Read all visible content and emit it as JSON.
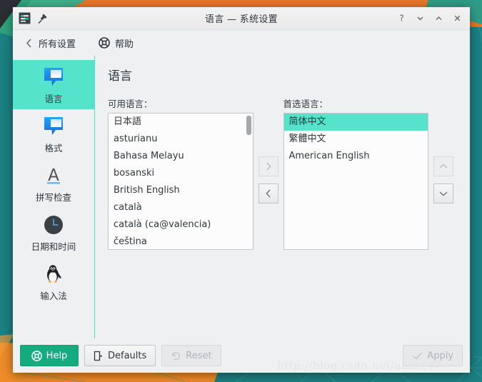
{
  "window": {
    "title": "语言 — 系统设置",
    "app_icon": "settings-sliders-icon",
    "pin_icon": "pin-icon",
    "controls": [
      {
        "name": "help-button",
        "glyph": "?"
      },
      {
        "name": "minimize-button",
        "glyph": "⌄"
      },
      {
        "name": "maximize-button",
        "glyph": "⌃"
      },
      {
        "name": "close-button",
        "glyph": "✕"
      }
    ]
  },
  "toolbar": {
    "back_label": "所有设置",
    "back_icon": "chevron-left-icon",
    "help_label": "帮助",
    "help_icon": "lifebuoy-icon"
  },
  "sidebar": {
    "items": [
      {
        "label": "语言",
        "icon": "speech-bubble-icon",
        "selected": true
      },
      {
        "label": "格式",
        "icon": "speech-bubble-icon",
        "selected": false
      },
      {
        "label": "拼写检查",
        "icon": "letter-a-underline-icon",
        "selected": false
      },
      {
        "label": "日期和时间",
        "icon": "clock-icon",
        "selected": false
      },
      {
        "label": "输入法",
        "icon": "tux-penguin-icon",
        "selected": false
      }
    ]
  },
  "main": {
    "page_title": "语言",
    "available": {
      "label": "可用语言：",
      "items": [
        "日本語",
        "asturianu",
        "Bahasa Melayu",
        "bosanski",
        "British English",
        "català",
        "català (ca@valencia)",
        "čeština"
      ],
      "scrollbar": true
    },
    "preferred": {
      "label": "首选语言：",
      "items": [
        {
          "text": "简体中文",
          "selected": true
        },
        {
          "text": "繁體中文",
          "selected": false
        },
        {
          "text": "American English",
          "selected": false
        }
      ]
    },
    "transfer_buttons": [
      {
        "name": "add-language-button",
        "icon": "chevron-right-icon",
        "glyph": "›",
        "disabled": true
      },
      {
        "name": "remove-language-button",
        "icon": "chevron-left-icon",
        "glyph": "‹",
        "disabled": false
      }
    ],
    "move_buttons": [
      {
        "name": "move-up-button",
        "icon": "chevron-up-icon",
        "glyph": "⌃",
        "disabled": true
      },
      {
        "name": "move-down-button",
        "icon": "chevron-down-icon",
        "glyph": "⌄",
        "disabled": false
      }
    ]
  },
  "footer": {
    "help_label": "Help",
    "help_icon": "lifebuoy-icon",
    "defaults_label": "Defaults",
    "defaults_icon": "document-revert-icon",
    "reset_label": "Reset",
    "reset_icon": "undo-arrow-icon",
    "apply_label": "Apply",
    "apply_icon": "check-icon"
  },
  "watermark": "http://blog.csdn.net/aaazz47",
  "colors": {
    "accent_teal": "#55e3cb",
    "help_green": "#16ab7e",
    "window_bg": "#eff0f1",
    "desktop_teal": "#1c8184",
    "desktop_orange": "#e8762a"
  }
}
